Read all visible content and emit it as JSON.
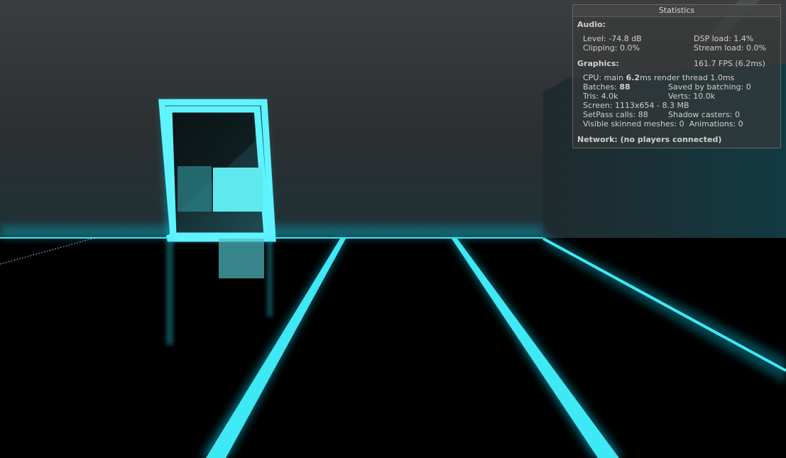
{
  "colors": {
    "neon": "#3ee8f4",
    "neon_glow": "#00c8e6",
    "wall": "#2a2d2f",
    "floor": "#000000"
  },
  "statistics": {
    "title": "Statistics",
    "audio": {
      "heading": "Audio:",
      "level": "Level: -74.8 dB",
      "dsp_load": "DSP load: 1.4%",
      "clipping": "Clipping: 0.0%",
      "stream_load": "Stream load: 0.0%"
    },
    "graphics": {
      "heading": "Graphics:",
      "fps": "161.7 FPS (6.2ms)",
      "cpu_prefix": "CPU: main",
      "cpu_main": "6.2",
      "cpu_suffix": "ms  render thread 1.0ms",
      "batches_prefix": "Batches:",
      "batches": "88",
      "saved_by_batching": "Saved by batching: 0",
      "tris": "Tris: 4.0k",
      "verts": "Verts: 10.0k",
      "screen": "Screen: 1113x654 - 8.3 MB",
      "setpass": "SetPass calls: 88",
      "shadow_casters": "Shadow casters: 0",
      "skinned_meshes": "Visible skinned meshes: 0",
      "animations": "Animations: 0"
    },
    "network": {
      "heading": "Network: (no players connected)"
    }
  }
}
